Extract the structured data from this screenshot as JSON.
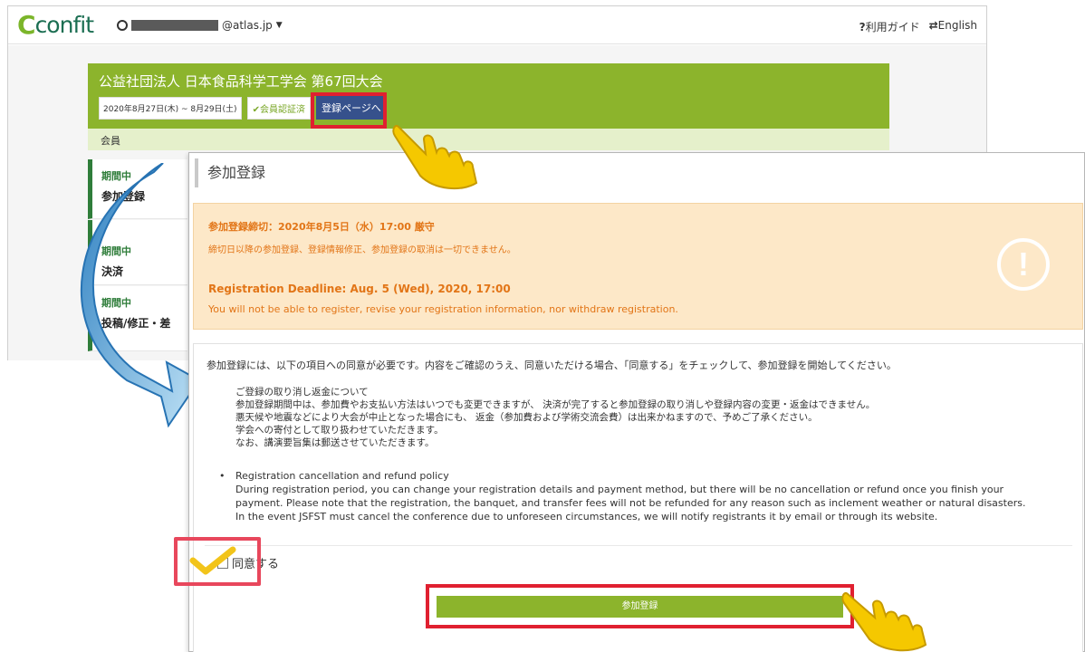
{
  "app": {
    "logo_text": "confit",
    "account_suffix": "@atlas.jp",
    "guide_label": "利用ガイド",
    "language_label": "English"
  },
  "conference": {
    "title": "公益社団法人 日本食品科学工学会 第67回大会",
    "dates": "2020年8月27日(木) ~ 8月29日(土)",
    "verified_label": "会員認証済",
    "register_page_button": "登録ページへ",
    "members_label": "会員"
  },
  "status_items": [
    {
      "status": "期間中",
      "name": "参加登録"
    },
    {
      "status": "期間中",
      "name": "決済"
    },
    {
      "status": "期間中",
      "name": "投稿/修正・差"
    }
  ],
  "registration": {
    "heading": "参加登録",
    "warning": {
      "jp_deadline": "参加登録締切：2020年8月5日（水）17:00 厳守",
      "jp_note": "締切日以降の参加登録、登録情報修正、参加登録の取消は一切できません。",
      "en_deadline": "Registration Deadline: Aug. 5 (Wed), 2020, 17:00",
      "en_note": "You will not be able to register, revise your registration information, nor withdraw registration."
    },
    "terms": {
      "intro": "参加登録には、以下の項目への同意が必要です。内容をご確認のうえ、同意いただける場合、「同意する」をチェックして、参加登録を開始してください。",
      "jp_lines": [
        "ご登録の取り消し返金について",
        "参加登録期間中は、参加費やお支払い方法はいつでも変更できますが、 決済が完了すると参加登録の取り消しや登録内容の変更・返金はできません。",
        "悪天候や地震などにより大会が中止となった場合にも、 返金（参加費および学術交流会費）は出来かねますので、予めご了承ください。",
        "学会への寄付として取り扱わせていただきます。",
        "なお、講演要旨集は郵送させていただきます。"
      ],
      "en_lines": [
        "Registration cancellation and refund policy",
        "During registration period, you can change your registration details and payment method, but there will be no cancellation or refund once you finish your",
        "payment. Please note that the registration, the banquet, and transfer fees will not be refunded for any reason such as inclement weather or natural disasters.",
        "In the event JSFST must cancel the conference due to unforeseen circumstances, we will notify registrants it by email or through its website."
      ]
    },
    "agree_label": "同意する",
    "submit_label": "参加登録"
  },
  "colors": {
    "brand_green": "#8cb42c",
    "status_green": "#2f7d3a",
    "warning_bg": "#fde8c8",
    "warning_text": "#e27517",
    "highlight_red": "#e02030",
    "button_blue": "#36518c"
  }
}
